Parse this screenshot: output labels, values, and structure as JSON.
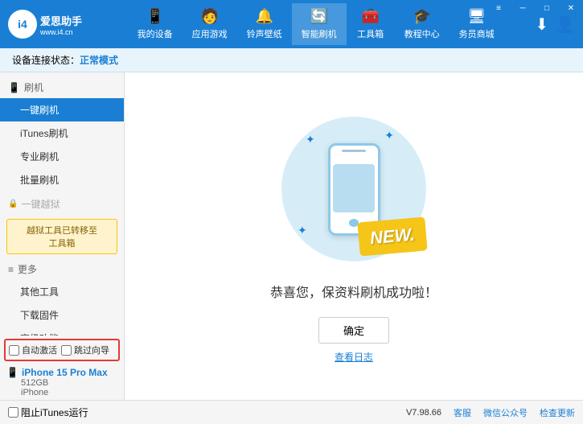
{
  "app": {
    "logo_icon": "i4",
    "logo_main": "爱思助手",
    "logo_sub": "www.i4.cn"
  },
  "nav": {
    "items": [
      {
        "id": "my-device",
        "icon": "📱",
        "label": "我的设备"
      },
      {
        "id": "apps-games",
        "icon": "👤",
        "label": "应用游戏"
      },
      {
        "id": "ringtones",
        "icon": "🔔",
        "label": "铃声壁纸"
      },
      {
        "id": "smart-flash",
        "icon": "🔄",
        "label": "智能刷机",
        "active": true
      },
      {
        "id": "toolbox",
        "icon": "🧰",
        "label": "工具箱"
      },
      {
        "id": "tutorial",
        "icon": "🎓",
        "label": "教程中心"
      },
      {
        "id": "service",
        "icon": "🖥",
        "label": "务员商城"
      }
    ]
  },
  "win_controls": {
    "wifi": "≡",
    "minimize": "─",
    "restore": "□",
    "close": "✕"
  },
  "status_bar": {
    "label": "设备连接状态：",
    "mode": "正常模式"
  },
  "sidebar": {
    "groups": [
      {
        "id": "flash",
        "header_icon": "📱",
        "header_label": "刷机",
        "items": [
          {
            "id": "one-key-flash",
            "label": "一键刷机",
            "active": true
          },
          {
            "id": "itunes-flash",
            "label": "iTunes刷机"
          },
          {
            "id": "pro-flash",
            "label": "专业刷机"
          },
          {
            "id": "batch-flash",
            "label": "批量刷机"
          }
        ]
      }
    ],
    "disabled_item": {
      "icon": "🔒",
      "label": "一键越狱"
    },
    "notice": "越狱工具已转移至\n工具箱",
    "more_group": {
      "header_icon": "≡",
      "header_label": "更多",
      "items": [
        {
          "id": "other-tools",
          "label": "其他工具"
        },
        {
          "id": "download-firmware",
          "label": "下载固件"
        },
        {
          "id": "advanced",
          "label": "高级功能"
        }
      ]
    }
  },
  "sidebar_bottom": {
    "auto_activate_label": "自动激活",
    "guide_label": "跳过向导",
    "device_icon": "📱",
    "device_name": "iPhone 15 Pro Max",
    "device_storage": "512GB",
    "device_type": "iPhone"
  },
  "content": {
    "success_text": "恭喜您，保资料刷机成功啦！",
    "confirm_button": "确定",
    "log_link": "查看日志"
  },
  "bottom_bar": {
    "itunes_checkbox": "阻止iTunes运行",
    "version": "V7.98.66",
    "links": [
      "客服",
      "微信公众号",
      "检查更新"
    ]
  },
  "phone_new_label": "NEW."
}
